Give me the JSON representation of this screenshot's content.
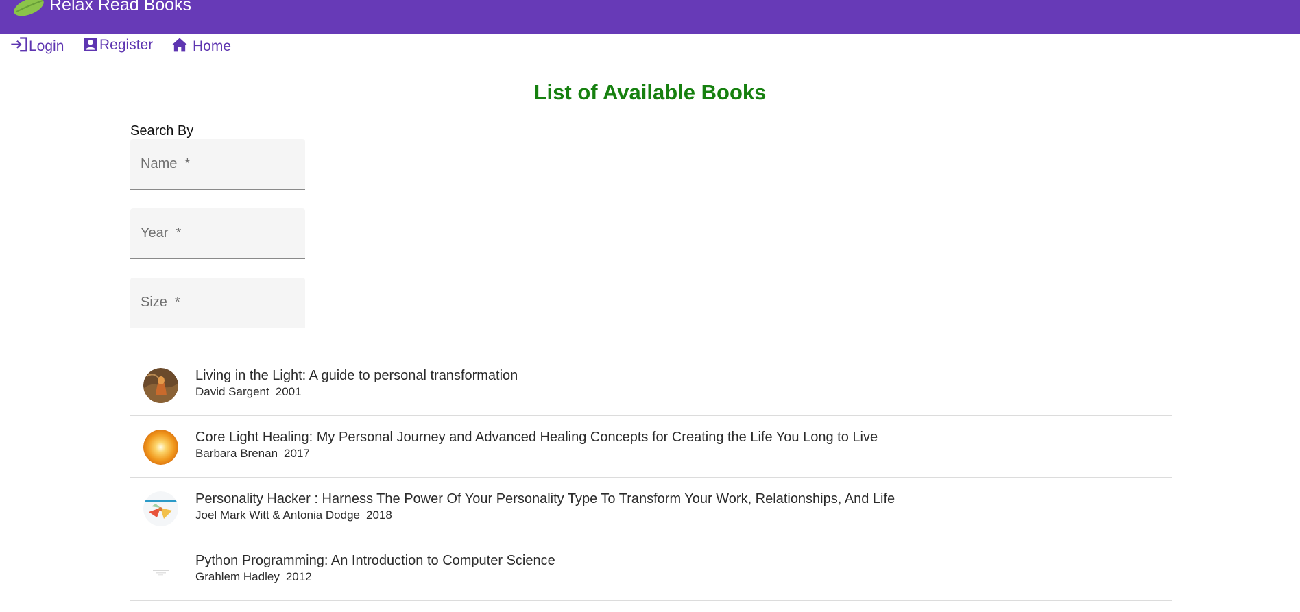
{
  "header": {
    "app_title": "Relax Read Books",
    "brand_color": "#673ab7",
    "logo_icon": "leaf-icon"
  },
  "nav": {
    "login": {
      "label": "Login",
      "icon": "login-icon"
    },
    "register": {
      "label": "Register",
      "icon": "account-box-icon"
    },
    "home": {
      "label": "Home",
      "icon": "home-icon"
    },
    "link_color": "#5e35b1"
  },
  "main": {
    "title": "List of Available Books",
    "title_color": "#16800f",
    "search": {
      "label": "Search By",
      "fields": {
        "name": {
          "placeholder": "Name  *",
          "value": ""
        },
        "year": {
          "placeholder": "Year  *",
          "value": ""
        },
        "size": {
          "placeholder": "Size  *",
          "value": ""
        }
      }
    },
    "books": [
      {
        "title": "Living in the Light: A guide to personal transformation",
        "author": "David Sargent",
        "year": "2001",
        "cover_icon": "book-cover-living-in-the-light"
      },
      {
        "title": "Core Light Healing: My Personal Journey and Advanced Healing Concepts for Creating the Life You Long to Live",
        "author": "Barbara Brenan",
        "year": "2017",
        "cover_icon": "book-cover-core-light-healing"
      },
      {
        "title": "Personality Hacker : Harness The Power Of Your Personality Type To Transform Your Work, Relationships, And Life",
        "author": "Joel Mark Witt & Antonia Dodge",
        "year": "2018",
        "cover_icon": "book-cover-personality-hacker"
      },
      {
        "title": " Python Programming: An Introduction to Computer Science",
        "author": "Grahlem Hadley",
        "year": "2012",
        "cover_icon": "book-cover-python-programming"
      }
    ]
  }
}
